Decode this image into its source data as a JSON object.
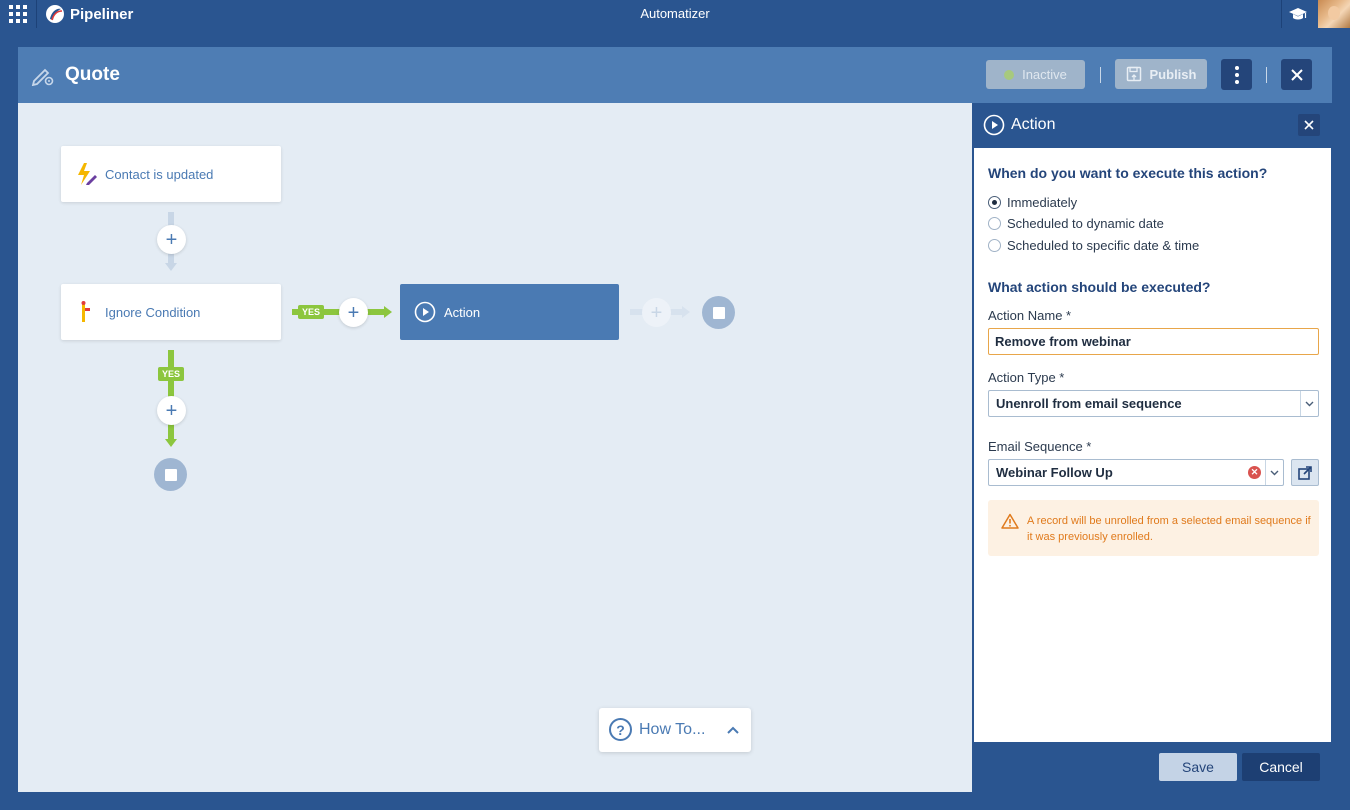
{
  "topbar": {
    "brand": "Pipeliner",
    "app_title": "Automatizer"
  },
  "editor": {
    "title": "Quote",
    "inactive_label": "Inactive",
    "publish_label": "Publish"
  },
  "canvas": {
    "trigger_label": "Contact is updated",
    "condition_label": "Ignore Condition",
    "action_label": "Action",
    "yes_label": "YES",
    "plus_symbol": "+",
    "howto_label": "How To...",
    "howto_q": "?"
  },
  "panel": {
    "title": "Action",
    "q_when": "When do you want to execute this action?",
    "options": [
      "Immediately",
      "Scheduled to dynamic date",
      "Scheduled to specific date & time"
    ],
    "selected_option": "Immediately",
    "q_what": "What action should be executed?",
    "action_name_label": "Action Name *",
    "action_name_value": "Remove from webinar",
    "action_type_label": "Action Type *",
    "action_type_value": "Unenroll from email sequence",
    "email_sequence_label": "Email Sequence *",
    "email_sequence_value": "Webinar Follow Up",
    "warning_text": "A record will be unrolled from a selected email sequence if it was previously enrolled.",
    "save_label": "Save",
    "cancel_label": "Cancel"
  },
  "colors": {
    "brand_blue": "#2a5590",
    "header_blue": "#4e7db4",
    "yes_green": "#8cc63e",
    "warning_orange": "#e07a1c"
  }
}
